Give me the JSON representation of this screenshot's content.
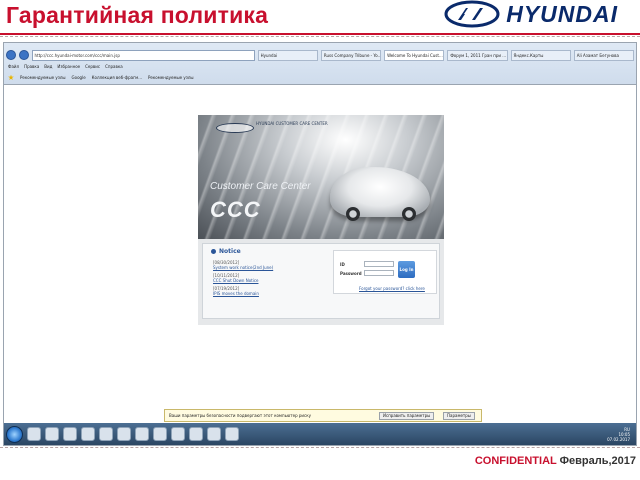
{
  "slide": {
    "title": "Гарантийная политика",
    "brand": "HYUNDAI",
    "confidential": "CONFIDENTIAL",
    "date": "Февраль,2017"
  },
  "browser": {
    "address": "http://ccc.hyundai-motor.com/ccc/main.jsp",
    "tabs": [
      "Hyundai",
      "Russ Company Tribune - Yo...",
      "Welcome To Hyundai Cust...",
      "Форум 1, 2011 Гран при ...",
      "Яндекс.Карты",
      "Ali Азамат Бегунова"
    ],
    "active_tab": 2,
    "menu": [
      "Файл",
      "Правка",
      "Вид",
      "Избранное",
      "Сервис",
      "Справка"
    ],
    "favorites": [
      "Рекомендуемые узлы",
      "Google",
      "Коллекция веб-фрагм...",
      "Рекомендуемые узлы"
    ]
  },
  "ccc": {
    "logo_text": "HYUNDAI\nCUSTOMER CARE CENTER",
    "subtitle": "Customer Care Center",
    "big": "CCC",
    "notice_title": "Notice",
    "notices": [
      {
        "date": "[08/30/2012]",
        "link": "System work notice(2nd June)"
      },
      {
        "date": "[10/11/2012]",
        "link": "CCC Shut Down Notice"
      },
      {
        "date": "[07/19/2012]",
        "link": "IPIS moves the domain"
      }
    ],
    "id_label": "ID",
    "pw_label": "Password",
    "login_btn": "Log In",
    "forgot": "Forgot your password? click here"
  },
  "infobar": {
    "text": "Ваши параметры безопасности подвергают этот компьютер риску",
    "btn1": "Исправить параметры",
    "btn2": "Параметры"
  },
  "taskbar": {
    "time": "10:05",
    "date": "07.02.2017",
    "lang": "RU"
  }
}
